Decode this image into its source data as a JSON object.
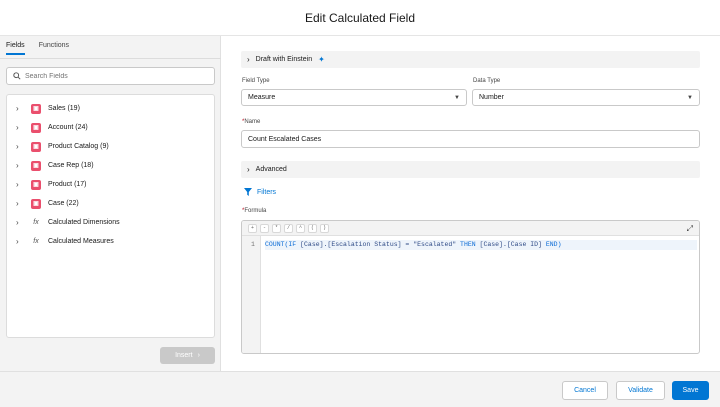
{
  "header": {
    "title": "Edit Calculated Field"
  },
  "left_panel": {
    "tabs": [
      {
        "label": "Fields",
        "active": true
      },
      {
        "label": "Functions",
        "active": false
      }
    ],
    "search": {
      "placeholder": "Search Fields"
    },
    "items": [
      {
        "label": "Sales (19)",
        "icon": "object-icon"
      },
      {
        "label": "Account (24)",
        "icon": "object-icon"
      },
      {
        "label": "Product Catalog (9)",
        "icon": "object-icon"
      },
      {
        "label": "Case Rep (18)",
        "icon": "object-icon"
      },
      {
        "label": "Product (17)",
        "icon": "object-icon"
      },
      {
        "label": "Case (22)",
        "icon": "object-icon"
      },
      {
        "label": "Calculated Dimensions",
        "icon": "fx-icon"
      },
      {
        "label": "Calculated Measures",
        "icon": "fx-icon"
      }
    ],
    "insert_label": "Insert"
  },
  "form": {
    "draft_label": "Draft with Einstein",
    "field_type": {
      "label": "Field Type",
      "value": "Measure"
    },
    "data_type": {
      "label": "Data Type",
      "value": "Number"
    },
    "name": {
      "label": "Name",
      "value": "Count Escalated Cases"
    },
    "advanced_label": "Advanced",
    "filters_label": "Filters",
    "formula": {
      "label": "Formula",
      "operators": [
        "+",
        "-",
        "*",
        "/",
        "^",
        "(",
        ")"
      ],
      "line_number": "1",
      "code": {
        "fn": "COUNT(",
        "kw_if": "IF",
        "cond": " [Case].[Escalation Status] = \"Escalated\" ",
        "kw_then": "THEN",
        "result": " [Case].[Case ID] ",
        "kw_end": "END",
        "close": ")"
      }
    }
  },
  "footer": {
    "cancel_label": "Cancel",
    "validate_label": "Validate",
    "save_label": "Save"
  },
  "colors": {
    "brand": "#0176d3",
    "object_icon": "#ea4f6d",
    "required": "#ba0517"
  }
}
